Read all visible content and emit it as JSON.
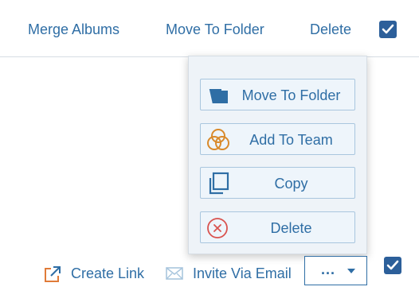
{
  "toolbar": {
    "merge_albums": "Merge Albums",
    "move_to_folder": "Move To Folder",
    "delete": "Delete",
    "select_all_checked": true
  },
  "context_menu": {
    "items": [
      {
        "label": "Move To Folder",
        "icon": "folder-icon"
      },
      {
        "label": "Add To Team",
        "icon": "team-icon"
      },
      {
        "label": "Copy",
        "icon": "copy-icon"
      },
      {
        "label": "Delete",
        "icon": "delete-circle-icon"
      }
    ]
  },
  "bottom_bar": {
    "create_link": "Create Link",
    "invite_via_email": "Invite Via Email",
    "more_button": "...",
    "item_checked": true
  },
  "colors": {
    "link": "#2f6ea5",
    "checkbox": "#2c5f9a",
    "team_icon": "#d98a2b",
    "delete_icon": "#d9534f",
    "create_link_icon": "#e07b39"
  }
}
